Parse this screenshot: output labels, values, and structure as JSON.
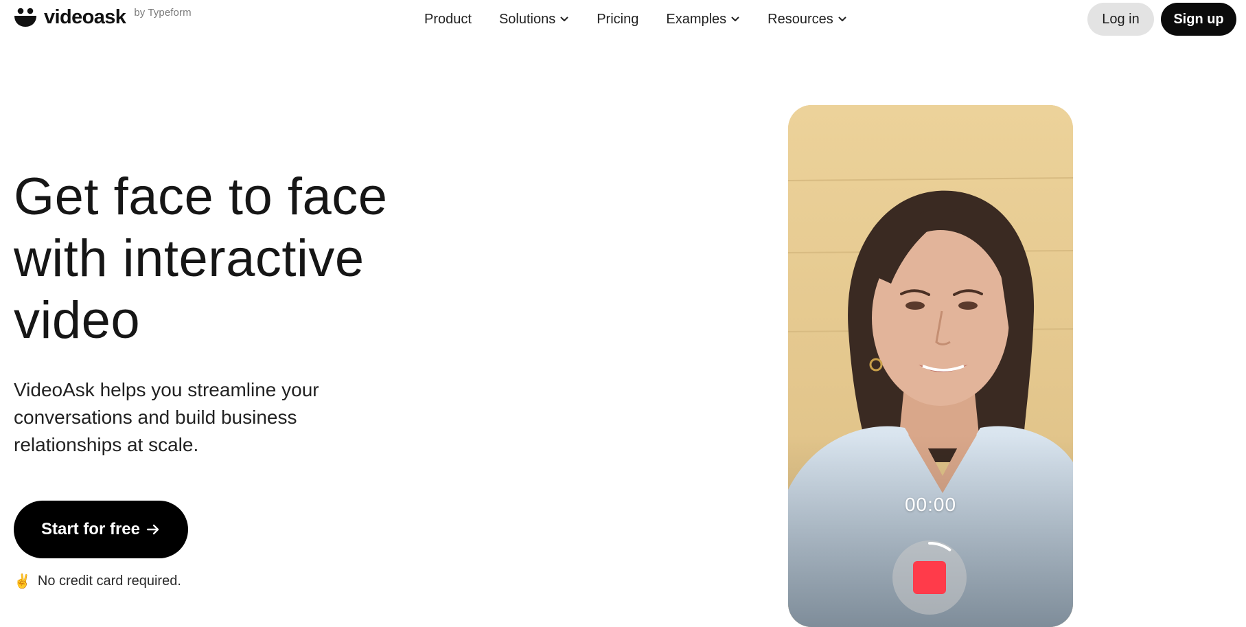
{
  "brand": {
    "name": "videoask",
    "by": "by Typeform"
  },
  "nav": {
    "items": [
      {
        "label": "Product",
        "dropdown": false
      },
      {
        "label": "Solutions",
        "dropdown": true
      },
      {
        "label": "Pricing",
        "dropdown": false
      },
      {
        "label": "Examples",
        "dropdown": true
      },
      {
        "label": "Resources",
        "dropdown": true
      }
    ],
    "login_label": "Log in",
    "signup_label": "Sign up"
  },
  "hero": {
    "title_lines": [
      "Get face to face",
      "with interactive",
      "video"
    ],
    "subtitle_lines": [
      "VideoAsk helps you streamline your",
      "conversations and build business",
      "relationships at scale."
    ],
    "cta_label": "Start for free",
    "cta_icon": "arrow-right-icon",
    "note_emoji": "✌️",
    "note_text": "No credit card required."
  },
  "video": {
    "timer": "00:00",
    "record_progress": 0.1,
    "colors": {
      "background": "#e9cc8f",
      "record_stop": "#ff3b4a"
    }
  },
  "colors": {
    "primary_button": "#0b0b0b",
    "secondary_button": "#e3e3e3",
    "text": "#191919"
  }
}
